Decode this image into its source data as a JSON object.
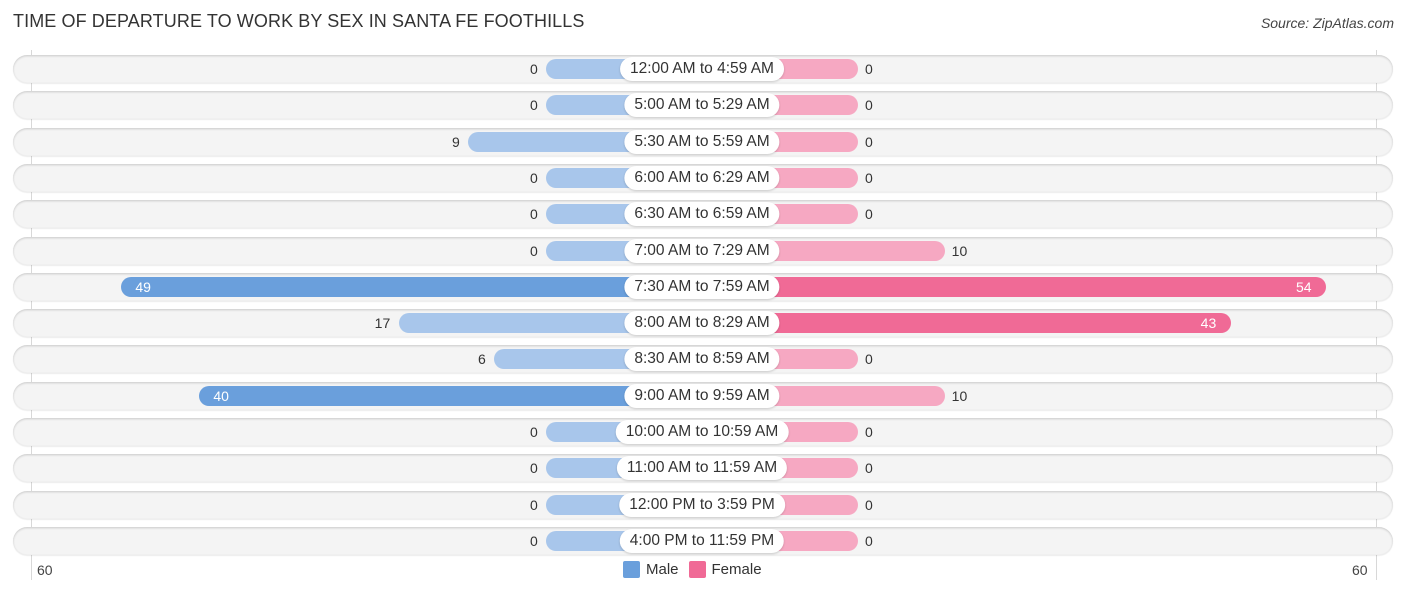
{
  "chart_data": {
    "type": "bar",
    "orientation": "horizontal-diverging",
    "title": "TIME OF DEPARTURE TO WORK BY SEX IN SANTA FE FOOTHILLS",
    "source": "Source: ZipAtlas.com",
    "categories": [
      "12:00 AM to 4:59 AM",
      "5:00 AM to 5:29 AM",
      "5:30 AM to 5:59 AM",
      "6:00 AM to 6:29 AM",
      "6:30 AM to 6:59 AM",
      "7:00 AM to 7:29 AM",
      "7:30 AM to 7:59 AM",
      "8:00 AM to 8:29 AM",
      "8:30 AM to 8:59 AM",
      "9:00 AM to 9:59 AM",
      "10:00 AM to 10:59 AM",
      "11:00 AM to 11:59 AM",
      "12:00 PM to 3:59 PM",
      "4:00 PM to 11:59 PM"
    ],
    "series": [
      {
        "name": "Male",
        "color": "#6a9fdc",
        "light_color": "#a8c6eb",
        "values": [
          0,
          0,
          9,
          0,
          0,
          0,
          49,
          17,
          6,
          40,
          0,
          0,
          0,
          0
        ]
      },
      {
        "name": "Female",
        "color": "#f06a96",
        "light_color": "#f6a8c2",
        "values": [
          0,
          0,
          0,
          0,
          0,
          10,
          54,
          43,
          0,
          10,
          0,
          0,
          0,
          0
        ]
      }
    ],
    "axis": {
      "left_max_label": "60",
      "right_max_label": "60",
      "range": [
        0,
        60
      ]
    },
    "legend": {
      "placement": "bottom-center",
      "items": [
        "Male",
        "Female"
      ]
    },
    "grid": false
  }
}
